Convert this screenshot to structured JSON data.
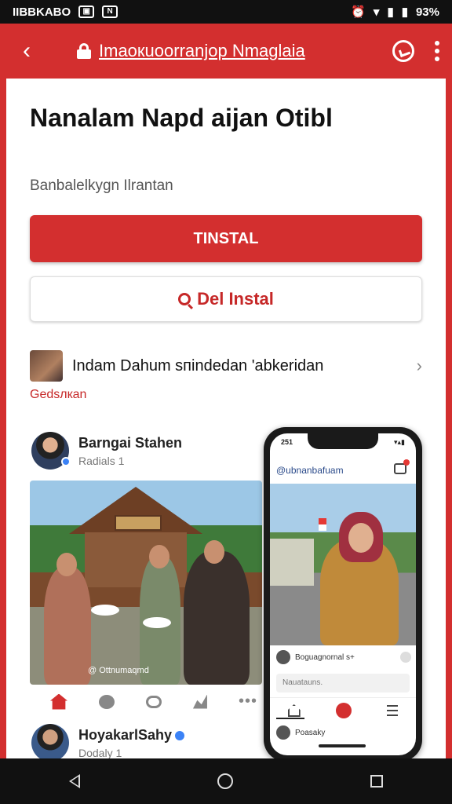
{
  "status_bar": {
    "carrier": "IIBBKABO",
    "badge1": "▣",
    "badge2": "N",
    "battery": "93%"
  },
  "app_bar": {
    "url": "Imaoкuoorranjор Nmaglaia"
  },
  "main": {
    "title": "Nanalam Napd aijan Otibl",
    "subtitle": "Banbalelkуgn Ilrantan",
    "install_label": "TINSTAL",
    "secondary_label": "Del Instal",
    "promo_text": "Indam Dahum sпіndedan 'abkеridan",
    "promo_tag": "Gedsлкan"
  },
  "post1": {
    "name": "Barngai Stahen",
    "sub": "Radials 1",
    "caption": "@ Ottnumaqmd"
  },
  "post2": {
    "name": "HoyakarlSahy",
    "sub": "Dodaly 1"
  },
  "phone": {
    "time": "251",
    "signal": "▾▴▮",
    "header": "@ubnanbafuam",
    "comment": "Boguаgnоrnal s+",
    "input_placeholder": "Nauatauns.",
    "bottom_user": "Poasaky"
  },
  "colors": {
    "brand": "#d32f2f",
    "accent_text": "#c62828",
    "verified": "#3b82f6"
  }
}
